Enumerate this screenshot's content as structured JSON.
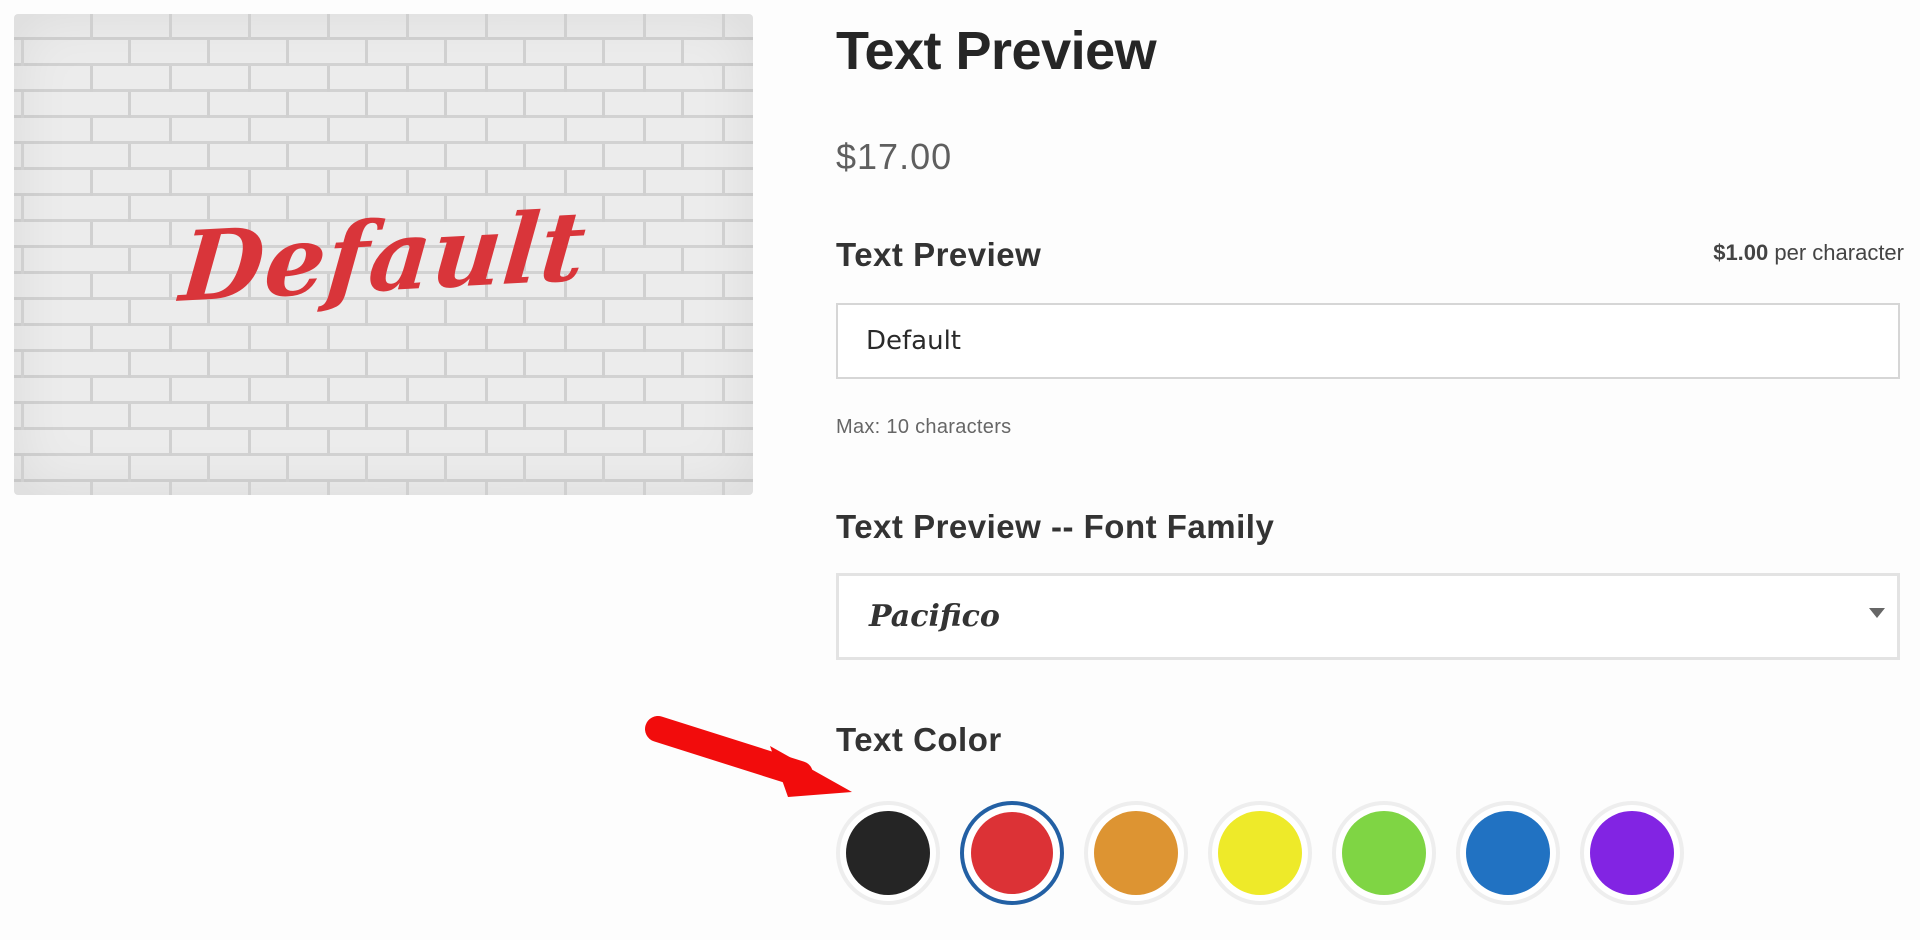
{
  "product": {
    "title": "Text Preview",
    "price": "$17.00",
    "image_text": "Default"
  },
  "text_field": {
    "label": "Text Preview",
    "per_char_amount": "$1.00",
    "per_char_suffix": " per character",
    "value": "Default",
    "hint": "Max: 10 characters"
  },
  "font_family": {
    "label": "Text Preview -- Font Family",
    "selected": "Pacifico"
  },
  "text_color": {
    "label": "Text Color",
    "selected": "red",
    "swatches": [
      {
        "name": "black",
        "color": "#252525"
      },
      {
        "name": "red",
        "color": "#dc3236"
      },
      {
        "name": "orange",
        "color": "#dd9432"
      },
      {
        "name": "yellow",
        "color": "#eeea29"
      },
      {
        "name": "green",
        "color": "#7fd544"
      },
      {
        "name": "blue",
        "color": "#2172c2"
      },
      {
        "name": "purple",
        "color": "#8224e3"
      }
    ]
  },
  "annotation": {
    "arrow_color": "#f20c0c",
    "icon": "arrow-icon"
  }
}
